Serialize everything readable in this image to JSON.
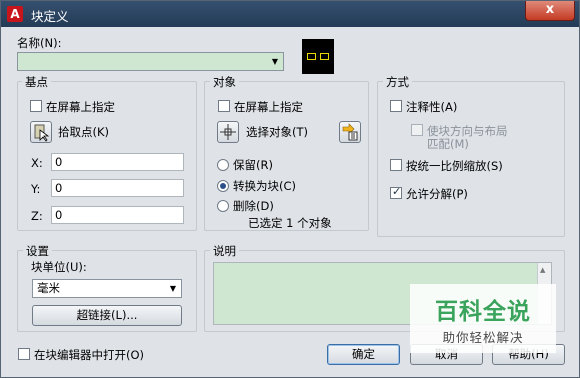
{
  "window": {
    "title": "块定义",
    "close_glyph": "x",
    "app_icon_letter": "A"
  },
  "name": {
    "label": "名称(N):",
    "value": ""
  },
  "base_point": {
    "title": "基点",
    "specify_on_screen": "在屏幕上指定",
    "pick_point": "拾取点(K)",
    "x_label": "X:",
    "x_value": "0",
    "y_label": "Y:",
    "y_value": "0",
    "z_label": "Z:",
    "z_value": "0"
  },
  "objects": {
    "title": "对象",
    "specify_on_screen": "在屏幕上指定",
    "select_objects": "选择对象(T)",
    "retain": "保留(R)",
    "convert_to_block": "转换为块(C)",
    "delete": "删除(D)",
    "selected_count_text": "已选定 1 个对象",
    "selected_option": "convert_to_block"
  },
  "behavior": {
    "title": "方式",
    "annotative": "注释性(A)",
    "match_orientation_line1": "使块方向与布局",
    "match_orientation_line2": "匹配(M)",
    "scale_uniformly": "按统一比例缩放(S)",
    "allow_exploding": "允许分解(P)",
    "allow_exploding_checked": true
  },
  "settings": {
    "title": "设置",
    "unit_label": "块单位(U):",
    "unit_value": "毫米",
    "hyperlink": "超链接(L)..."
  },
  "description": {
    "title": "说明",
    "value": ""
  },
  "footer": {
    "open_in_editor": "在块编辑器中打开(O)",
    "ok": "确定",
    "cancel": "取消",
    "help": "帮助(H)"
  },
  "watermark": {
    "line1": "百科全说",
    "line2": "助你轻松解决"
  },
  "colors": {
    "field_green": "#cfe7d1",
    "title_bar": "#2d4664",
    "watermark_green": "#3aa35c"
  }
}
